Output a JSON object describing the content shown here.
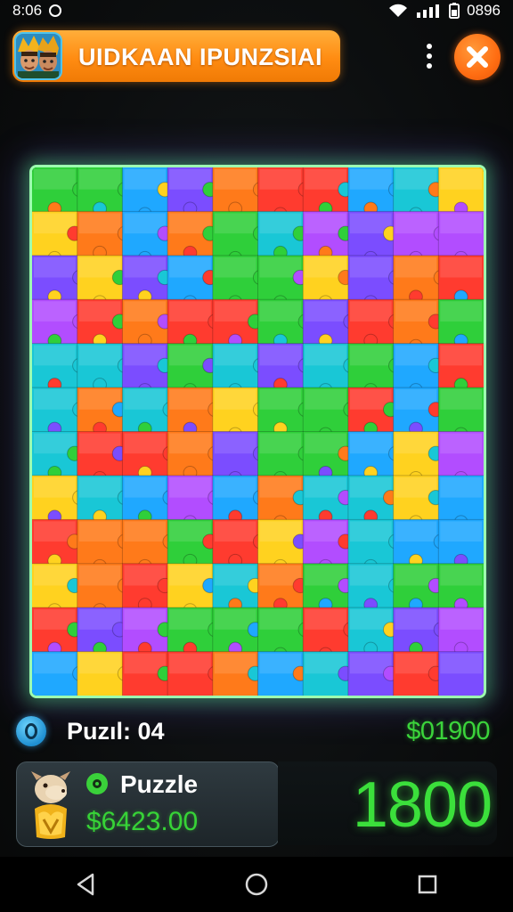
{
  "status_bar": {
    "time": "8:06",
    "battery": "0896"
  },
  "header": {
    "title": "UIDKAAN IPUNZSIAI"
  },
  "board": {
    "rows": 12,
    "cols": 10
  },
  "info": {
    "level_label": "Puzıl: 04",
    "total_score": "$01900"
  },
  "card": {
    "title": "Puzzle",
    "amount": "$6423.00"
  },
  "score": {
    "value": "1800"
  },
  "colors": {
    "accent_orange": "#ff8c12",
    "score_green": "#3bdf3b",
    "board_border": "#9dffb0",
    "pieces": [
      "#ff3b2f",
      "#ff7a1a",
      "#ffd21f",
      "#2fcf3a",
      "#1fa8ff",
      "#7b4dff",
      "#b24dff",
      "#19c7d6"
    ]
  },
  "icons": {
    "close": "close-icon",
    "menu": "more-vertical-icon",
    "level": "level-badge-icon",
    "back": "back-triangle-icon",
    "home": "home-circle-icon",
    "recents": "recents-square-icon"
  }
}
